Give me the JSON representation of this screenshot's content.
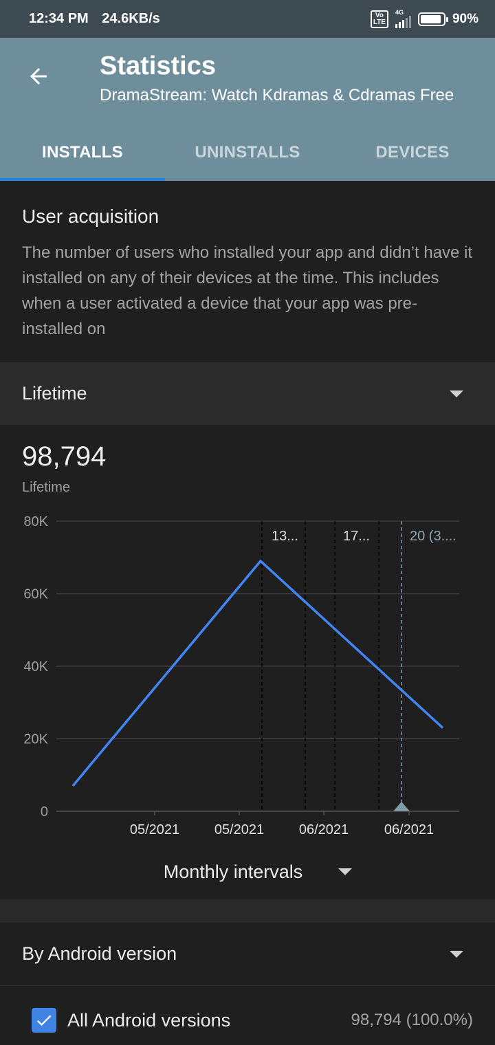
{
  "status_bar": {
    "time": "12:34 PM",
    "speed": "24.6KB/s",
    "network": "4G",
    "volte": "Vo LTE",
    "battery": "90%",
    "battery_level": 0.9
  },
  "app_bar": {
    "title": "Statistics",
    "subtitle": "DramaStream: Watch Kdramas & Cdramas Free",
    "tabs": [
      {
        "label": "INSTALLS",
        "active": true
      },
      {
        "label": "UNINSTALLS",
        "active": false
      },
      {
        "label": "DEVICES",
        "active": false
      }
    ]
  },
  "description": {
    "heading": "User acquisition",
    "body": "The number of users who installed your app and didn’t have it installed on any of their devices at the time. This includes when a user activated a device that your app was pre-installed on"
  },
  "range_selector": {
    "value": "Lifetime"
  },
  "summary": {
    "value": "98,794",
    "caption": "Lifetime"
  },
  "chart_data": {
    "type": "line",
    "ylim": [
      0,
      80000
    ],
    "y_ticks": [
      0,
      20000,
      40000,
      60000,
      80000
    ],
    "y_tick_labels": [
      "0",
      "20K",
      "40K",
      "60K",
      "80K"
    ],
    "x_tick_labels": [
      "05/2021",
      "05/2021",
      "06/2021",
      "06/2021"
    ],
    "series": [
      {
        "values": [
          7000,
          69000,
          23000
        ],
        "color": "#4285f4"
      }
    ],
    "annotations": [
      "13...",
      "17...",
      "20 (3...."
    ],
    "grid": true
  },
  "interval_selector": {
    "value": "Monthly intervals"
  },
  "android_version": {
    "heading": "By Android version",
    "rows": [
      {
        "label": "All Android versions",
        "value": "98,794 (100.0%)",
        "checked": true
      }
    ]
  }
}
